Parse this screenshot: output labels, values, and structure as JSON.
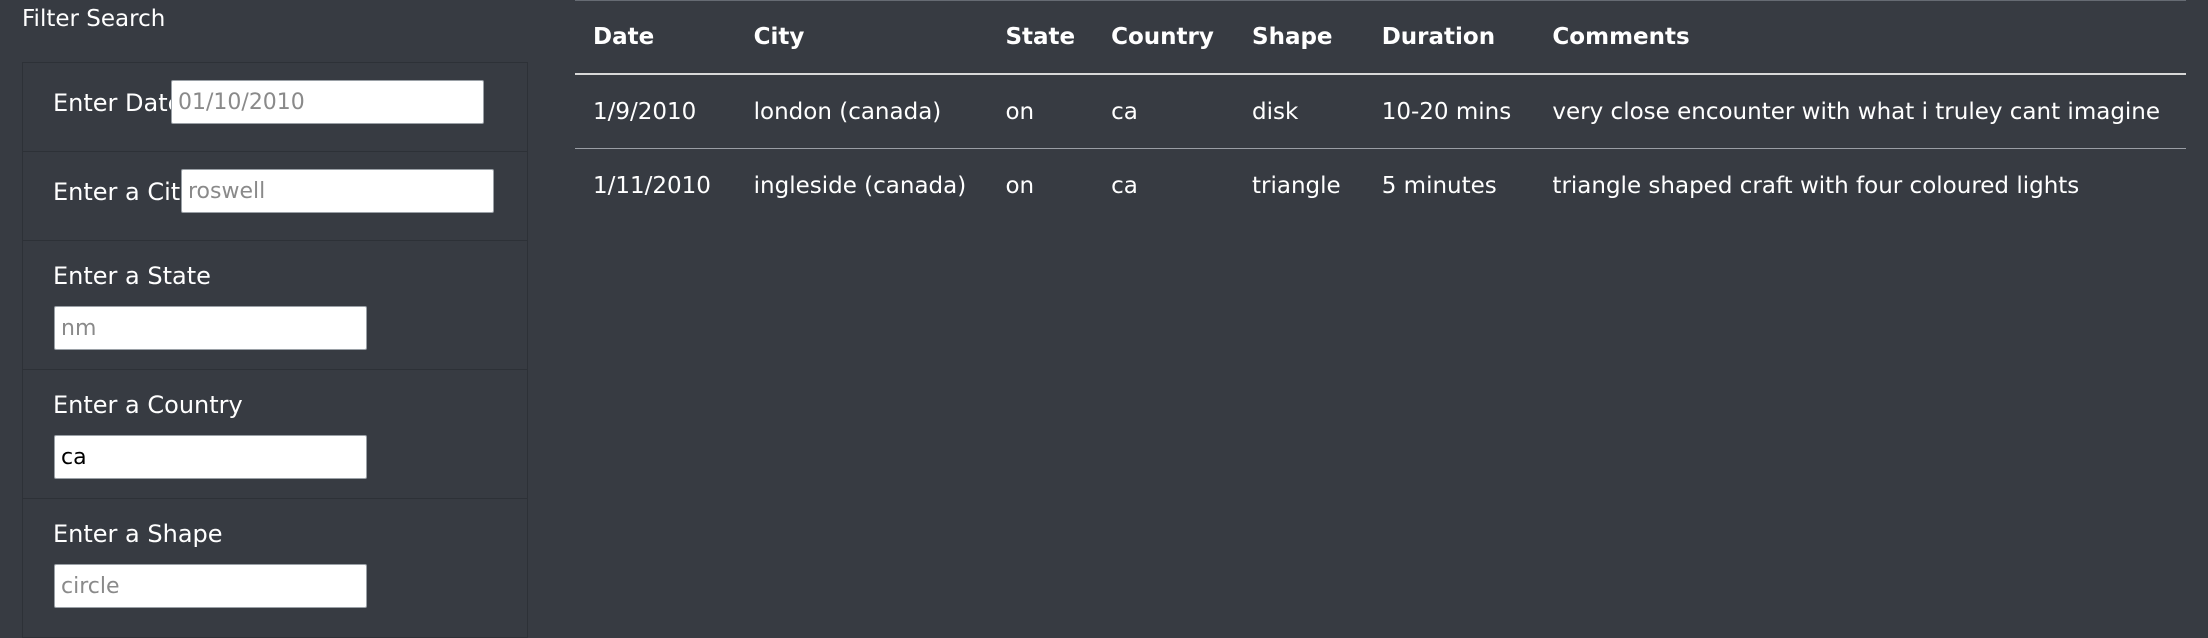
{
  "filters": {
    "title": "Filter Search",
    "date": {
      "label": "Enter Date",
      "placeholder": "01/10/2010",
      "value": ""
    },
    "city": {
      "label": "Enter a City",
      "placeholder": "roswell",
      "value": ""
    },
    "state": {
      "label": "Enter a State",
      "placeholder": "nm",
      "value": ""
    },
    "country": {
      "label": "Enter a Country",
      "placeholder": "",
      "value": "ca"
    },
    "shape": {
      "label": "Enter a Shape",
      "placeholder": "circle",
      "value": ""
    }
  },
  "table": {
    "headers": [
      "Date",
      "City",
      "State",
      "Country",
      "Shape",
      "Duration",
      "Comments"
    ],
    "rows": [
      [
        "1/9/2010",
        "london (canada)",
        "on",
        "ca",
        "disk",
        "10-20 mins",
        "very close encounter with what i truley cant imagine"
      ],
      [
        "1/11/2010",
        "ingleside (canada)",
        "on",
        "ca",
        "triangle",
        "5 minutes",
        "triangle shaped craft with four coloured lights"
      ]
    ]
  }
}
